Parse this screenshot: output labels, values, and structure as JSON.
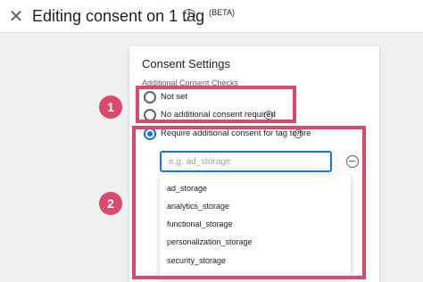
{
  "header": {
    "close_icon": "close-icon",
    "title": "Editing consent on 1 tag",
    "beta": "(BETA)",
    "info_icon": "info-icon"
  },
  "consent_settings": {
    "title": "Consent Settings",
    "section_label": "Additional Consent Checks",
    "options": [
      {
        "label": "Not set",
        "selected": false
      },
      {
        "label": "No additional consent required",
        "selected": false
      },
      {
        "label": "Require additional consent for tag to fire",
        "selected": true
      }
    ],
    "consent_input": {
      "placeholder": "e.g. ad_storage",
      "value": ""
    },
    "dropdown_items": [
      "ad_storage",
      "analytics_storage",
      "functional_storage",
      "personalization_storage",
      "security_storage"
    ]
  },
  "annotations": {
    "badge_1": "1",
    "badge_2": "2",
    "highlight_color": "#d94a6d"
  },
  "colors": {
    "accent": "#1a73e8",
    "background": "#eef0f2"
  }
}
